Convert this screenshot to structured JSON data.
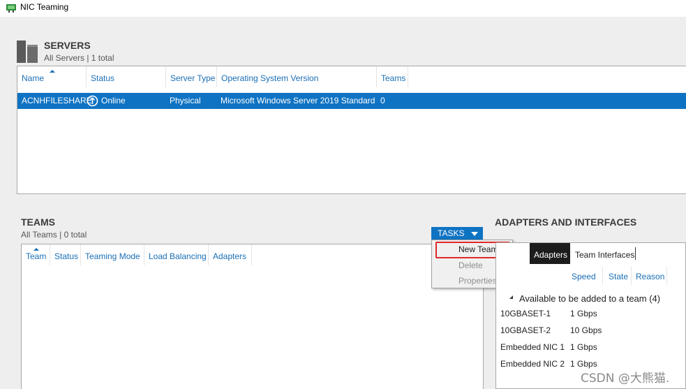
{
  "window": {
    "title": "NIC Teaming"
  },
  "servers": {
    "title": "SERVERS",
    "subtitle": "All Servers | 1 total",
    "columns": [
      "Name",
      "Status",
      "Server Type",
      "Operating System Version",
      "Teams"
    ],
    "rows": [
      {
        "name": "ACNHFILESHARE",
        "status": "Online",
        "server_type": "Physical",
        "os": "Microsoft Windows Server 2019 Standard",
        "teams": "0"
      }
    ]
  },
  "teams": {
    "title": "TEAMS",
    "subtitle": "All Teams | 0 total",
    "columns": [
      "Team",
      "Status",
      "Teaming Mode",
      "Load Balancing",
      "Adapters"
    ],
    "tasks_label": "TASKS",
    "menu": [
      "New Team",
      "Delete",
      "Properties"
    ]
  },
  "adapters": {
    "title": "ADAPTERS AND INTERFACES",
    "tabs": [
      "Adapters",
      "Team Interfaces"
    ],
    "columns": [
      "Speed",
      "State",
      "Reason"
    ],
    "group_label": "Available to be added to a team (4)",
    "rows": [
      {
        "name": "10GBASET-1",
        "speed": "1 Gbps"
      },
      {
        "name": "10GBASET-2",
        "speed": "10 Gbps"
      },
      {
        "name": "Embedded NIC 1",
        "speed": "1 Gbps"
      },
      {
        "name": "Embedded NIC 2",
        "speed": "1 Gbps"
      }
    ]
  },
  "watermark": "CSDN @大熊猫.",
  "colors": {
    "accent": "#0f73c3",
    "highlight": "#e0282a",
    "link": "#1a6fb5"
  }
}
